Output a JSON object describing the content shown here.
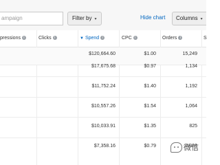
{
  "toolbar": {
    "search_placeholder": "ampaign",
    "filter_label": "Filter by",
    "filter_caret": "▾",
    "hide_chart_label": "Hide chart",
    "columns_label": "Columns",
    "columns_caret": "▾"
  },
  "table": {
    "headers": {
      "impressions": "pressions",
      "clicks": "Clicks",
      "spend": "Spend",
      "cpc": "CPC",
      "orders": "Orders",
      "next": "S"
    },
    "sort_indicator": "▼",
    "info_glyph": "i",
    "rows": [
      {
        "spend": "$120,664.60",
        "cpc": "$1.00",
        "orders": "15,249"
      },
      {
        "spend": "$17,675.68",
        "cpc": "$0.97",
        "orders": "1,134"
      },
      {
        "spend": "$11,752.24",
        "cpc": "$1.40",
        "orders": "1,192"
      },
      {
        "spend": "$10,557.26",
        "cpc": "$1.54",
        "orders": "1,064"
      },
      {
        "spend": "$10,033.91",
        "cpc": "$1.35",
        "orders": "825"
      },
      {
        "spend": "$7,358.16",
        "cpc": "$0.79",
        "orders": "2,084"
      }
    ]
  },
  "watermark": {
    "text": "微信"
  }
}
